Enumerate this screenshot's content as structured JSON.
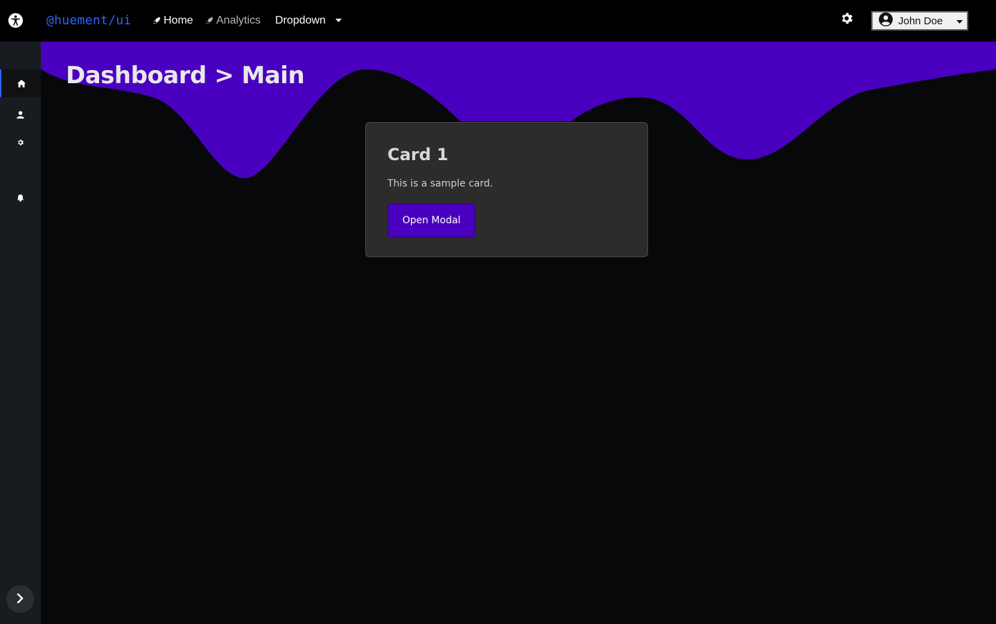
{
  "topbar": {
    "accessibility_icon": "accessibility-icon",
    "brand": "@huement/ui",
    "nav": [
      {
        "label": "Home",
        "icon": "rocket-icon"
      },
      {
        "label": "Analytics",
        "icon": "rocket-icon"
      },
      {
        "label": "Dropdown",
        "icon": "caret-down-icon"
      }
    ],
    "settings_icon": "gear-icon",
    "user": {
      "name": "John Doe",
      "icon": "user-circle-icon"
    }
  },
  "sidebar": {
    "items": [
      {
        "name": "home",
        "icon": "home-icon",
        "active": true
      },
      {
        "name": "profile",
        "icon": "user-icon",
        "active": false
      },
      {
        "name": "settings",
        "icon": "gear-icon",
        "active": false
      },
      {
        "name": "notifications",
        "icon": "bell-icon",
        "active": false
      }
    ],
    "expand_icon": "chevron-right-icon"
  },
  "main": {
    "title": "Dashboard > Main",
    "card": {
      "title": "Card 1",
      "text": "This is a sample card.",
      "button_label": "Open Modal"
    }
  },
  "colors": {
    "accent": "#4a00c0",
    "brand": "#2f63ff",
    "background": "#070809",
    "sidebar": "#181b1f",
    "card": "#2c2c2c"
  }
}
